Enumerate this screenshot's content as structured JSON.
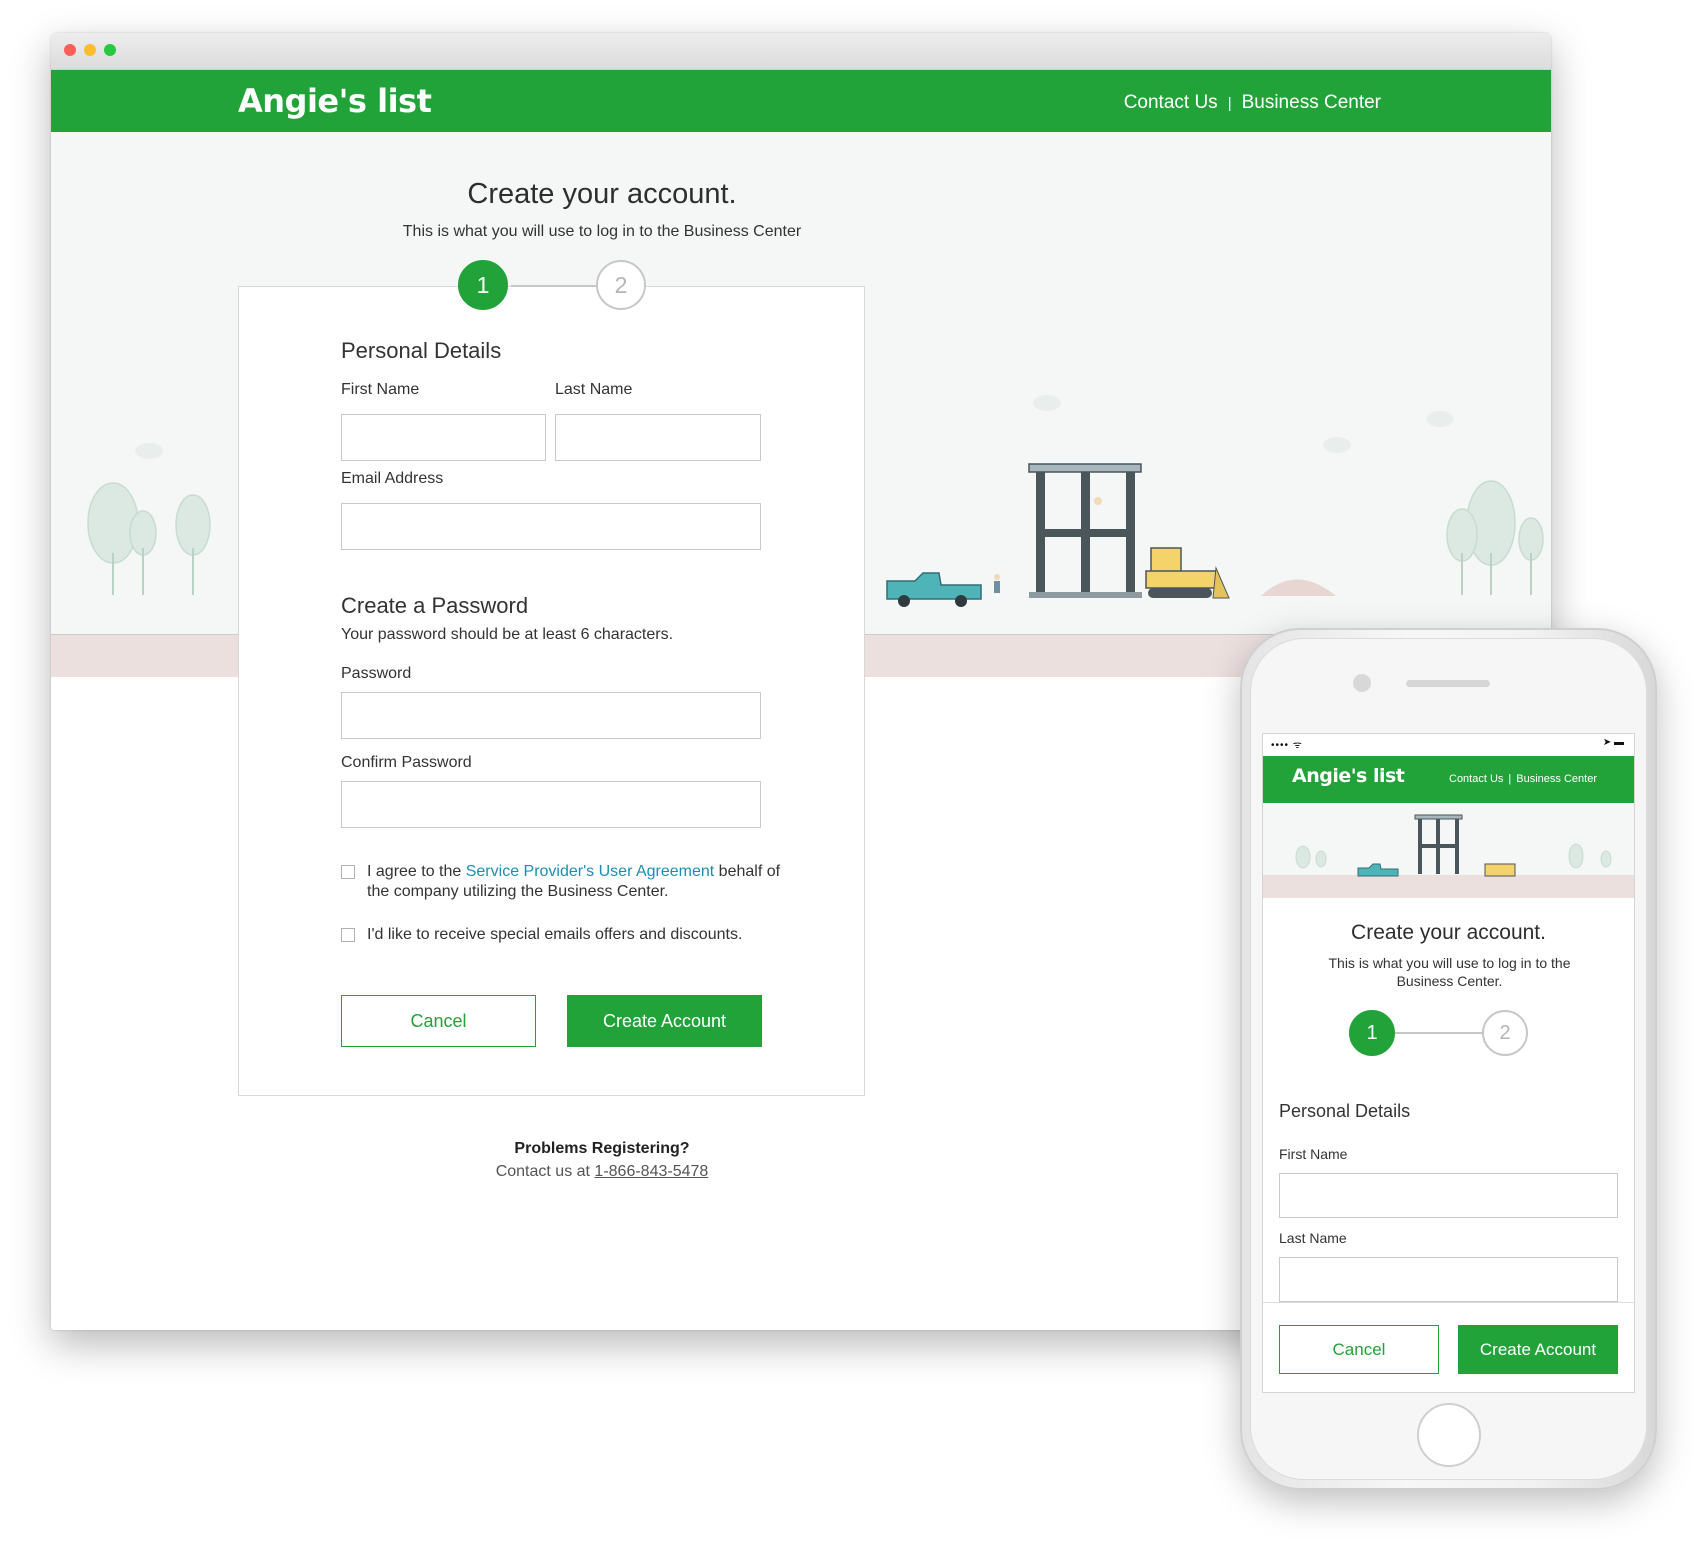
{
  "colors": {
    "brand_green": "#22a339",
    "link_blue": "#1a8fb5",
    "hero_bg": "#f4f7f6",
    "ground": "#ece0df"
  },
  "desktop": {
    "window_controls": [
      "close",
      "minimize",
      "zoom"
    ],
    "header": {
      "logo": "Angie's list",
      "nav": {
        "contact": "Contact Us",
        "separator": "|",
        "business": "Business Center"
      }
    },
    "page_title": "Create your account.",
    "page_subtitle": "This is what you will use to log in to the Business Center",
    "steps": [
      {
        "label": "1",
        "active": true
      },
      {
        "label": "2",
        "active": false
      }
    ],
    "form": {
      "personal_heading": "Personal Details",
      "first_name_label": "First Name",
      "first_name_value": "",
      "last_name_label": "Last Name",
      "last_name_value": "",
      "email_label": "Email Address",
      "email_value": "",
      "password_heading": "Create a Password",
      "password_hint": "Your password should be at least 6 characters.",
      "password_label": "Password",
      "password_value": "",
      "confirm_label": "Confirm Password",
      "confirm_value": "",
      "agree_prefix": "I agree to the ",
      "agree_link": "Service Provider's User Agreement",
      "agree_suffix": " behalf of",
      "agree_line2": "the company utilizing the Business Center.",
      "agree_checked": false,
      "offers_text": "I'd like to receive special emails offers and discounts.",
      "offers_checked": false,
      "cancel_label": "Cancel",
      "create_label": "Create Account"
    },
    "help": {
      "question": "Problems Registering?",
      "contact_prefix": "Contact us at ",
      "phone": "1-866-843-5478"
    }
  },
  "mobile": {
    "status_left": "•••• ᯤ",
    "status_right": "➤ ▬",
    "header": {
      "logo": "Angie's list",
      "nav": {
        "contact": "Contact Us",
        "separator": "|",
        "business": "Business Center"
      }
    },
    "page_title": "Create your account.",
    "page_subtitle": "This is what you will use to log in to the Business Center.",
    "steps": [
      {
        "label": "1",
        "active": true
      },
      {
        "label": "2",
        "active": false
      }
    ],
    "personal_heading": "Personal Details",
    "first_name_label": "First Name",
    "last_name_label": "Last Name",
    "cancel_label": "Cancel",
    "create_label": "Create Account"
  }
}
